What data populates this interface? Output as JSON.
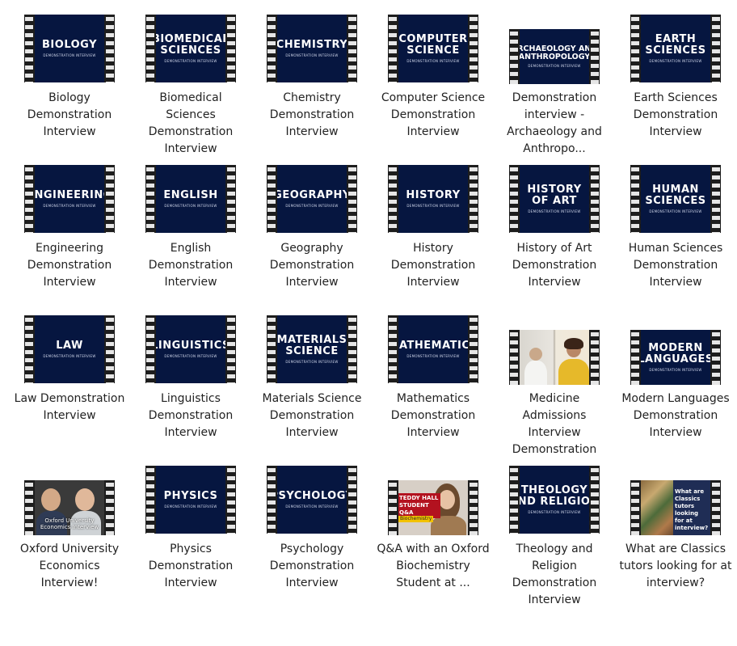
{
  "items": [
    {
      "label": "Biology Demonstration Interview",
      "thumb": {
        "title": "BIOLOGY",
        "sub": "DEMONSTRATION INTERVIEW"
      }
    },
    {
      "label": "Biomedical Sciences Demonstration Interview",
      "thumb": {
        "title": "BIOMEDICAL",
        "title2": "SCIENCES",
        "sub": "DEMONSTRATION INTERVIEW"
      }
    },
    {
      "label": "Chemistry Demonstration Interview",
      "thumb": {
        "title": "CHEMISTRY",
        "sub": "DEMONSTRATION INTERVIEW"
      }
    },
    {
      "label": "Computer Science Demonstration Interview",
      "thumb": {
        "title": "COMPUTER",
        "title2": "SCIENCE",
        "sub": "DEMONSTRATION INTERVIEW"
      }
    },
    {
      "label": "Demonstration interview - Archaeology and Anthropo...",
      "thumb": {
        "title": "ARCHAEOLOGY AND",
        "title2": "ANTHROPOLOGY",
        "sub": "DEMONSTRATION INTERVIEW"
      }
    },
    {
      "label": "Earth Sciences Demonstration Interview",
      "thumb": {
        "title": "EARTH",
        "title2": "SCIENCES",
        "sub": "DEMONSTRATION INTERVIEW"
      }
    },
    {
      "label": "Engineering Demonstration Interview",
      "thumb": {
        "title": "ENGINEERING",
        "sub": "DEMONSTRATION INTERVIEW"
      }
    },
    {
      "label": "English Demonstration Interview",
      "thumb": {
        "title": "ENGLISH",
        "sub": "DEMONSTRATION INTERVIEW"
      }
    },
    {
      "label": "Geography Demonstration Interview",
      "thumb": {
        "title": "GEOGRAPHY",
        "sub": "DEMONSTRATION INTERVIEW"
      }
    },
    {
      "label": "History Demonstration Interview",
      "thumb": {
        "title": "HISTORY",
        "sub": "DEMONSTRATION INTERVIEW"
      }
    },
    {
      "label": "History of Art Demonstration Interview",
      "thumb": {
        "title": "HISTORY",
        "title2": "OF ART",
        "sub": "DEMONSTRATION INTERVIEW"
      }
    },
    {
      "label": "Human Sciences Demonstration Interview",
      "thumb": {
        "title": "HUMAN",
        "title2": "SCIENCES",
        "sub": "DEMONSTRATION INTERVIEW"
      }
    },
    {
      "label": "Law Demonstration Interview",
      "thumb": {
        "title": "LAW",
        "sub": "DEMONSTRATION INTERVIEW"
      }
    },
    {
      "label": "Linguistics Demonstration Interview",
      "thumb": {
        "title": "LINGUISTICS",
        "sub": "DEMONSTRATION INTERVIEW"
      }
    },
    {
      "label": "Materials Science Demonstration Interview",
      "thumb": {
        "title": "MATERIALS",
        "title2": "SCIENCE",
        "sub": "DEMONSTRATION INTERVIEW"
      }
    },
    {
      "label": "Mathematics Demonstration Interview",
      "thumb": {
        "title": "MATHEMATICS",
        "sub": "DEMONSTRATION INTERVIEW"
      }
    },
    {
      "label": "Medicine Admissions Interview Demonstration",
      "thumb": {
        "video": "medicine"
      }
    },
    {
      "label": "Modern Languages Demonstration Interview",
      "thumb": {
        "title": "MODERN",
        "title2": "LANGUAGES",
        "sub": "DEMONSTRATION INTERVIEW"
      }
    },
    {
      "label": "Oxford University Economics Interview!",
      "thumb": {
        "video": "oxford",
        "caption": "Oxford University Economics Interview"
      }
    },
    {
      "label": "Physics Demonstration Interview",
      "thumb": {
        "title": "PHYSICS",
        "sub": "DEMONSTRATION INTERVIEW"
      }
    },
    {
      "label": "Psychology Demonstration Interview",
      "thumb": {
        "title": "PSYCHOLOGY",
        "sub": "DEMONSTRATION INTERVIEW"
      }
    },
    {
      "label": "Q&A with an Oxford Biochemistry Student at ...",
      "thumb": {
        "video": "qa",
        "caption": "TEDDY HALL STUDENT Q&A",
        "caption2": "Biochemistry"
      }
    },
    {
      "label": "Theology and Religion Demonstration Interview",
      "thumb": {
        "title": "THEOLOGY",
        "title2": "AND RELIGION",
        "sub": "DEMONSTRATION INTERVIEW"
      }
    },
    {
      "label": "What are Classics tutors looking for at interview?",
      "thumb": {
        "video": "classics",
        "caption": "What are Classics tutors looking for at interview?"
      }
    }
  ],
  "colors": {
    "frame_bg": "#061640",
    "film": "#1d1d1d",
    "label": "#222222"
  }
}
